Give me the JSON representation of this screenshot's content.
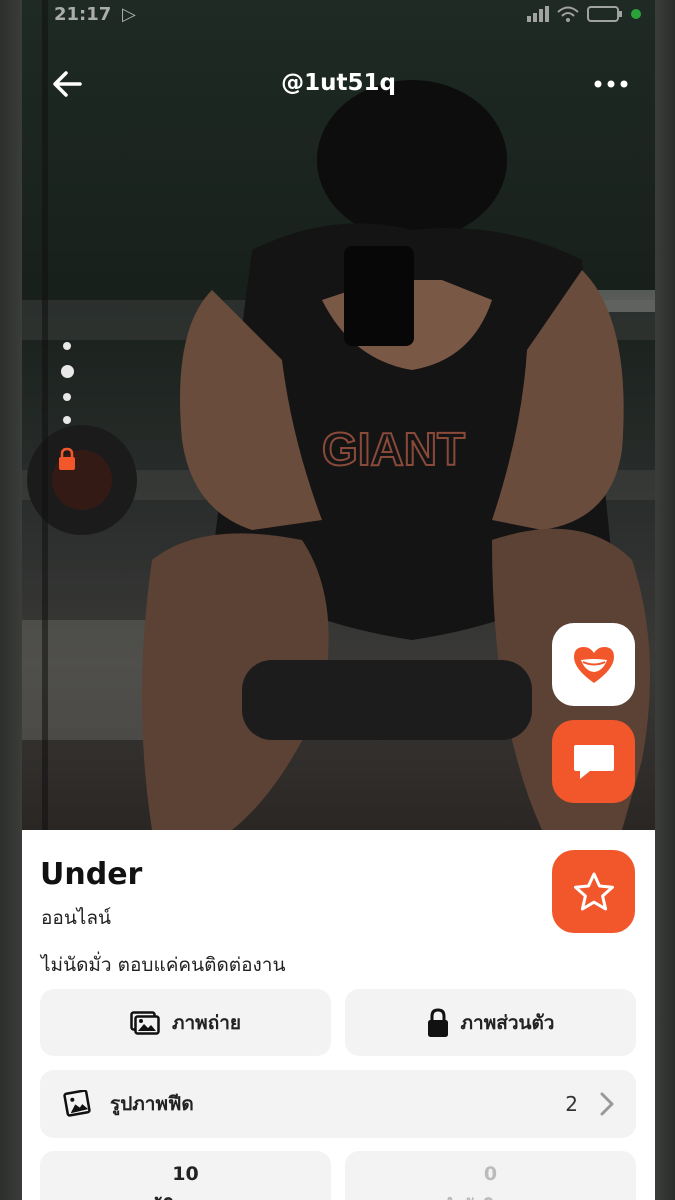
{
  "status_bar": {
    "time": "21:17"
  },
  "header": {
    "username": "@1ut51q",
    "back_icon": "arrow-left-icon",
    "more_icon": "more-dots-icon"
  },
  "gallery": {
    "photo_count": 4,
    "current_index": 2,
    "locked_indicator": "lock-icon"
  },
  "actions": {
    "like_icon": "heart-lips-icon",
    "chat_icon": "chat-bubble-icon",
    "favorite_icon": "star-icon"
  },
  "profile": {
    "name": "Under",
    "status": "ออนไลน์",
    "bio": "ไม่นัดมั่ว ตอบแค่คนติดต่องาน"
  },
  "tiles": {
    "photos_label": "ภาพถ่าย",
    "private_label": "ภาพส่วนตัว",
    "feed_label": "รูปภาพฟีด",
    "feed_count": "2"
  },
  "stats": {
    "left_value": "10",
    "left_label": "ผู้ติดตาม",
    "right_value": "0",
    "right_label": "กำลังติดตาม"
  },
  "colors": {
    "accent": "#f2572c",
    "tile_bg": "#f3f3f3",
    "online": "#2ecc40"
  }
}
